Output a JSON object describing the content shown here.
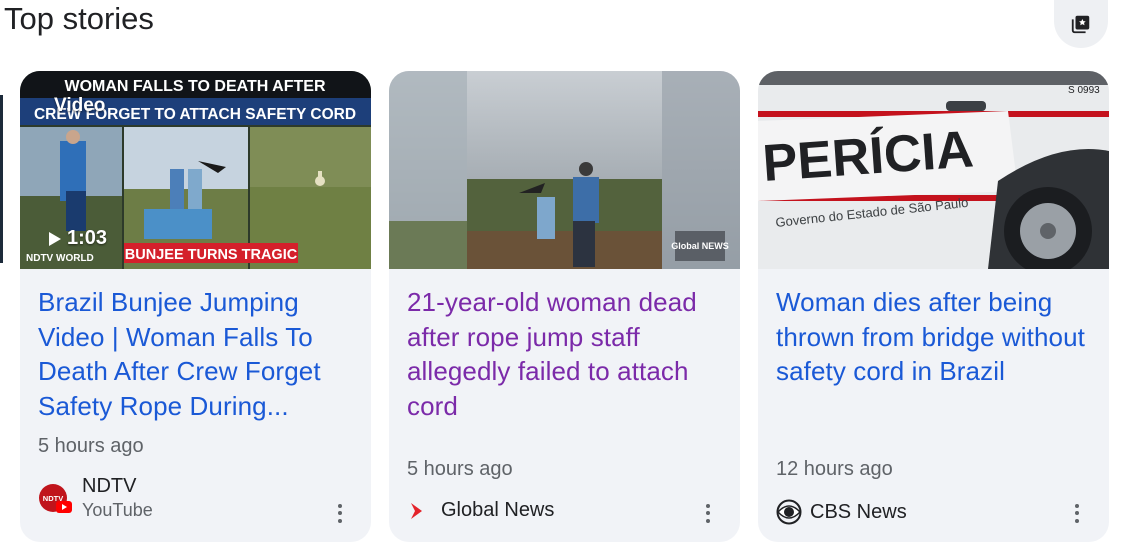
{
  "section": {
    "title": "Top stories"
  },
  "icons": {
    "collection": "add-to-collection-icon",
    "more": "more-vert-icon",
    "play": "play-icon"
  },
  "colors": {
    "headline_link": "#1a59d6",
    "headline_visited": "#7b2aa9",
    "card_bg": "#f1f3f7"
  },
  "cards": [
    {
      "thumb_overlay": {
        "video_label": "Video",
        "duration": "1:03",
        "banner_top": "WOMAN FALLS TO DEATH AFTER",
        "banner_bottom": "CREW FORGET TO ATTACH SAFETY CORD",
        "banner_tag": "BUNJEE TURNS TRAGIC",
        "logo": "NDTV WORLD"
      },
      "headline": "Brazil Bunjee Jumping Video | Woman Falls To Death After Crew Forget Safety Rope During...",
      "time": "5 hours ago",
      "source": "NDTV",
      "source_sub": "YouTube"
    },
    {
      "thumb_overlay": {
        "logo": "Global NEWS"
      },
      "headline": "21-year-old woman dead after rope jump staff allegedly failed to attach cord",
      "time": "5 hours ago",
      "source": "Global News"
    },
    {
      "thumb_overlay": {
        "plate": "S 0993",
        "door_text": "PERÍCIA",
        "door_sub": "Governo do Estado de São Paulo"
      },
      "headline": "Woman dies after being thrown from bridge without safety cord in Brazil",
      "time": "12 hours ago",
      "source": "CBS News"
    }
  ]
}
